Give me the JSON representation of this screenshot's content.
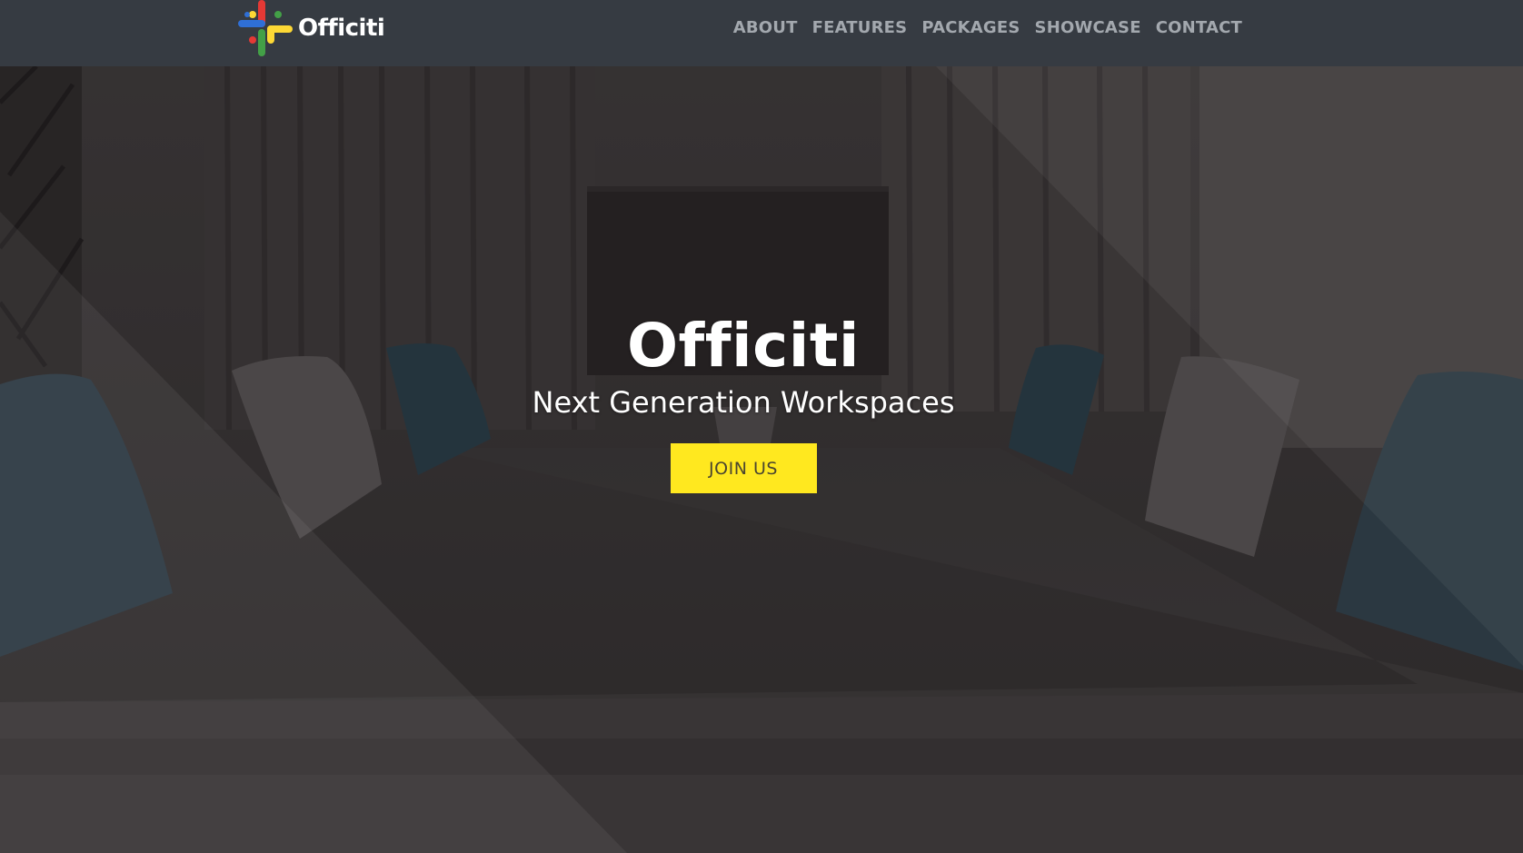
{
  "brand": {
    "name": "Officiti",
    "logo_icon": "plus-cross-logo-icon",
    "logo_colors": [
      "#2f6fd6",
      "#e53935",
      "#43a047",
      "#fdd835"
    ]
  },
  "nav": {
    "items": [
      {
        "label": "ABOUT"
      },
      {
        "label": "FEATURES"
      },
      {
        "label": "PACKAGES"
      },
      {
        "label": "SHOWCASE"
      },
      {
        "label": "CONTACT"
      }
    ]
  },
  "hero": {
    "title": "Officiti",
    "subtitle": "Next Generation Workspaces",
    "cta_label": "JOIN US"
  },
  "colors": {
    "navbar_bg": "#363b42",
    "nav_text": "#a3a8ae",
    "cta_bg": "#ffe81f",
    "overlay": "#2e2b2c"
  }
}
